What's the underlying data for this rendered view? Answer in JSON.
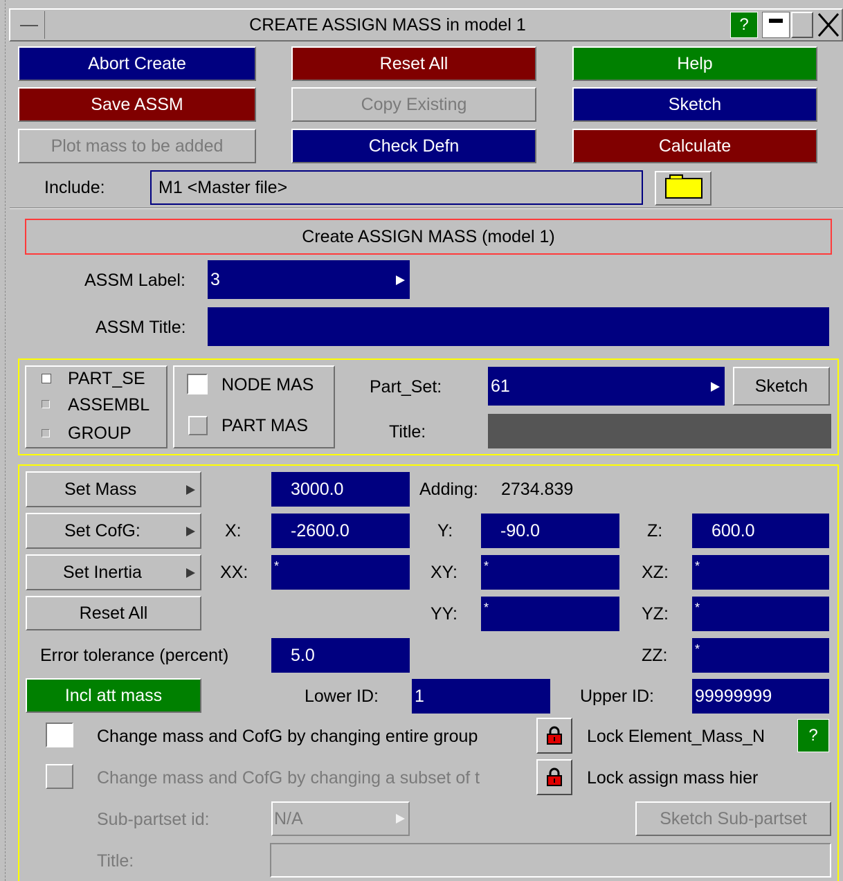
{
  "window": {
    "title": "CREATE ASSIGN MASS in model 1",
    "help_glyph": "?",
    "menu_icon": "system-menu-icon",
    "minimize_icon": "minimize-icon",
    "restore_icon": "restore-icon",
    "close_icon": "close-icon"
  },
  "toolbar": {
    "abort_create": "Abort Create",
    "reset_all": "Reset All",
    "help": "Help",
    "save_assm": "Save ASSM",
    "copy_existing": "Copy Existing",
    "sketch": "Sketch",
    "plot_mass": "Plot mass to be added",
    "check_defn": "Check Defn",
    "calculate": "Calculate"
  },
  "include": {
    "label": "Include:",
    "value": "M1  <Master file>",
    "folder_icon": "folder-icon"
  },
  "panel": {
    "header": "Create ASSIGN MASS (model 1)",
    "assm_label_caption": "ASSM Label:",
    "assm_label_value": "3",
    "assm_title_caption": "ASSM Title:",
    "assm_title_value": ""
  },
  "selection": {
    "part_se": "PART_SE",
    "assembl": "ASSEMBL",
    "group": "GROUP",
    "node_mas": "NODE MAS",
    "part_mas": "PART MAS",
    "part_set_label": "Part_Set:",
    "part_set_value": "61",
    "sketch": "Sketch",
    "title_label": "Title:",
    "title_value": ""
  },
  "mass": {
    "set_mass": "Set Mass",
    "mass_value": "3000.0",
    "adding_label": "Adding:",
    "adding_value": "2734.839",
    "set_cofg": "Set CofG:",
    "x_label": "X:",
    "x_value": "-2600.0",
    "y_label": "Y:",
    "y_value": "-90.0",
    "z_label": "Z:",
    "z_value": "600.0",
    "set_inertia": "Set Inertia",
    "xx_label": "XX:",
    "xx_value": "*",
    "xy_label": "XY:",
    "xy_value": "*",
    "xz_label": "XZ:",
    "xz_value": "*",
    "reset_all": "Reset All",
    "yy_label": "YY:",
    "yy_value": "*",
    "yz_label": "YZ:",
    "yz_value": "*",
    "tol_label": "Error tolerance (percent)",
    "tol_value": "5.0",
    "zz_label": "ZZ:",
    "zz_value": "*",
    "incl_att": "Incl att mass",
    "lower_label": "Lower ID:",
    "lower_value": "1",
    "upper_label": "Upper ID:",
    "upper_value": "99999999",
    "change_group": "Change mass and CofG by changing entire group",
    "lock_elem": "Lock Element_Mass_N",
    "help_glyph": "?",
    "change_subset": "Change mass and CofG by changing a subset of t",
    "lock_hier": "Lock assign mass hier",
    "subpartset_label": "Sub-partset id:",
    "subpartset_value": "N/A",
    "sketch_subpartset": "Sketch Sub-partset",
    "title_label": "Title:",
    "title_value": ""
  },
  "colors": {
    "window_bg": "#c0c0c0",
    "field_blue": "#000080",
    "button_red": "#800000",
    "button_green": "#008000",
    "frame_yellow": "#ffff00",
    "header_border": "#ff0000"
  }
}
